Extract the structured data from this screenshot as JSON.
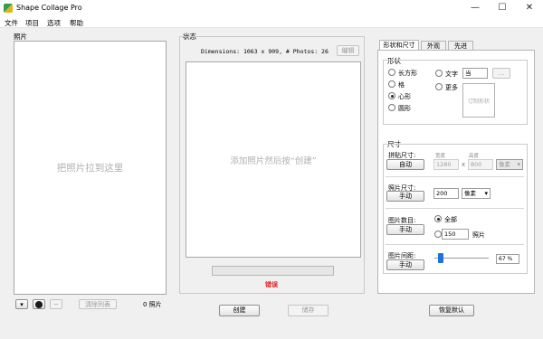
{
  "window": {
    "title": "Shape Collage Pro",
    "minimize": "—",
    "maximize": "☐",
    "close": "✕"
  },
  "menu": [
    "文件",
    "项目",
    "选项",
    "帮助"
  ],
  "photos": {
    "title": "照片",
    "placeholder": "把照片拉到这里",
    "add_btn": "▾",
    "remove_btn": "−",
    "clear_btn": "清除列表",
    "count": "0 照片"
  },
  "status": {
    "title": "状态",
    "info": "Dimensions: 1063 x 909, # Photos: 26",
    "edit_btn": "编辑",
    "preview_placeholder": "添加照片然后按“创建”",
    "error": "错误",
    "create_btn": "创建",
    "save_btn": "储存"
  },
  "tabs": [
    "形状和尺寸",
    "外观",
    "先进"
  ],
  "shape": {
    "title": "形状",
    "options": [
      "长方形",
      "格",
      "心形",
      "圆形"
    ],
    "selected": "心形",
    "text_label": "文字",
    "text_value": "当",
    "text_browse": "...",
    "more_label": "更多",
    "custom_label": "订制形状"
  },
  "size": {
    "title": "尺寸",
    "collage_size_label": "拼贴尺寸:",
    "auto_btn": "自动",
    "width_label": "宽度",
    "height_label": "高度",
    "width_value": "1280",
    "x_sep": "x",
    "height_value": "800",
    "unit_disabled": "像素",
    "photo_size_label": "照片尺寸:",
    "photo_size_btn": "手动",
    "photo_size_value": "200",
    "photo_size_unit": "像素",
    "photo_count_label": "图片数目:",
    "photo_count_btn": "手动",
    "count_all": "全部",
    "count_value": "150",
    "count_unit": "照片",
    "spacing_label": "图片间距:",
    "spacing_btn": "手动",
    "spacing_percent": "67 %",
    "spacing_level": 0.12
  },
  "defaults_btn": "恢复默认",
  "colors": {
    "error": "#e01b1b",
    "slider": "#1e73d9"
  }
}
